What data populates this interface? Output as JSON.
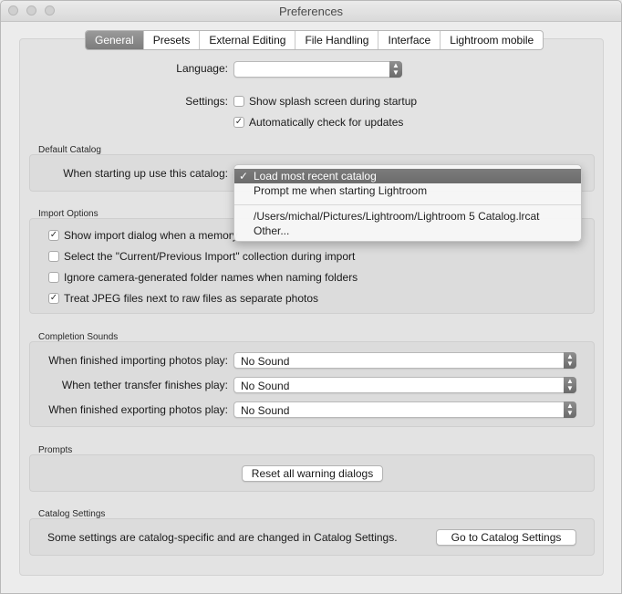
{
  "window": {
    "title": "Preferences"
  },
  "tabs": [
    "General",
    "Presets",
    "External Editing",
    "File Handling",
    "Interface",
    "Lightroom mobile"
  ],
  "general": {
    "language_label": "Language:",
    "language_value": "",
    "settings_label": "Settings:",
    "splash_label": "Show splash screen during startup",
    "splash_checked": false,
    "updates_label": "Automatically check for updates",
    "updates_checked": true
  },
  "default_catalog": {
    "title": "Default Catalog",
    "startup_label": "When starting up use this catalog:",
    "options": [
      {
        "label": "Load most recent catalog",
        "selected": true
      },
      {
        "label": "Prompt me when starting Lightroom",
        "selected": false
      },
      {
        "label": "/Users/michal/Pictures/Lightroom/Lightroom 5 Catalog.lrcat",
        "selected": false
      },
      {
        "label": "Other...",
        "selected": false
      }
    ],
    "checkmark": "✓"
  },
  "import_options": {
    "title": "Import Options",
    "items": [
      {
        "label": "Show import dialog when a memory",
        "checked": true
      },
      {
        "label": "Select the \"Current/Previous Import\" collection during import",
        "checked": false
      },
      {
        "label": "Ignore camera-generated folder names when naming folders",
        "checked": false
      },
      {
        "label": "Treat JPEG files next to raw files as separate photos",
        "checked": true
      }
    ]
  },
  "completion_sounds": {
    "title": "Completion Sounds",
    "rows": [
      {
        "label": "When finished importing photos play:",
        "value": "No Sound"
      },
      {
        "label": "When tether transfer finishes play:",
        "value": "No Sound"
      },
      {
        "label": "When finished exporting photos play:",
        "value": "No Sound"
      }
    ]
  },
  "prompts": {
    "title": "Prompts",
    "reset_button": "Reset all warning dialogs"
  },
  "catalog_settings": {
    "title": "Catalog Settings",
    "description": "Some settings are catalog-specific and are changed in Catalog Settings.",
    "button": "Go to Catalog Settings"
  },
  "icons": {
    "check": "✓",
    "up": "▲",
    "down": "▼"
  }
}
